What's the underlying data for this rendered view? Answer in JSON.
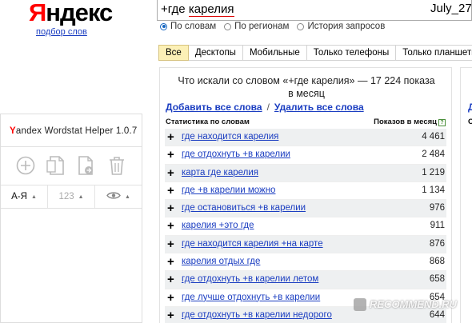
{
  "header": {
    "logo_first": "Я",
    "logo_rest": "ндекс",
    "logo_sub": "подбор слов",
    "query_prefix": "+где ",
    "query_word": "карелия",
    "date": "July_27"
  },
  "radio_options": [
    {
      "label": "По словам",
      "selected": true
    },
    {
      "label": "По регионам",
      "selected": false
    },
    {
      "label": "История запросов",
      "selected": false
    }
  ],
  "tabs": [
    "Все",
    "Десктопы",
    "Мобильные",
    "Только телефоны",
    "Только планшеты"
  ],
  "helper": {
    "title_first": "Y",
    "title_rest": "andex Wordstat Helper 1.0.7",
    "icons": [
      "add-circle-icon",
      "copy-icon",
      "export-icon",
      "trash-icon"
    ],
    "sort": [
      "А-Я",
      "123",
      "eye-icon"
    ]
  },
  "results": {
    "heading_line1": "Что искали со словом «+где карелия» — 17 224 показа",
    "heading_line2": "в месяц",
    "add_all": "Добавить все слова",
    "separator": "/",
    "remove_all": "Удалить все слова",
    "col_left": "Статистика по словам",
    "col_right": "Показов в месяц",
    "help_mark": "?",
    "rows": [
      {
        "keyword": "где находится карелия",
        "count": "4 461"
      },
      {
        "keyword": "где отдохнуть +в карелии",
        "count": "2 484"
      },
      {
        "keyword": "карта где карелия",
        "count": "1 219"
      },
      {
        "keyword": "где +в карелии можно",
        "count": "1 134"
      },
      {
        "keyword": "где остановиться +в карелии",
        "count": "976"
      },
      {
        "keyword": "карелия +это где",
        "count": "911"
      },
      {
        "keyword": "где находится карелия +на карте",
        "count": "876"
      },
      {
        "keyword": "карелия отдых где",
        "count": "868"
      },
      {
        "keyword": "где отдохнуть +в карелии летом",
        "count": "658"
      },
      {
        "keyword": "где лучше отдохнуть +в карелии",
        "count": "654"
      },
      {
        "keyword": "где отдохнуть +в карелии недорого",
        "count": "644"
      }
    ]
  },
  "right_panel": {
    "d1": "Д",
    "d2": "С"
  },
  "watermark": "RECOMMEND.RU"
}
